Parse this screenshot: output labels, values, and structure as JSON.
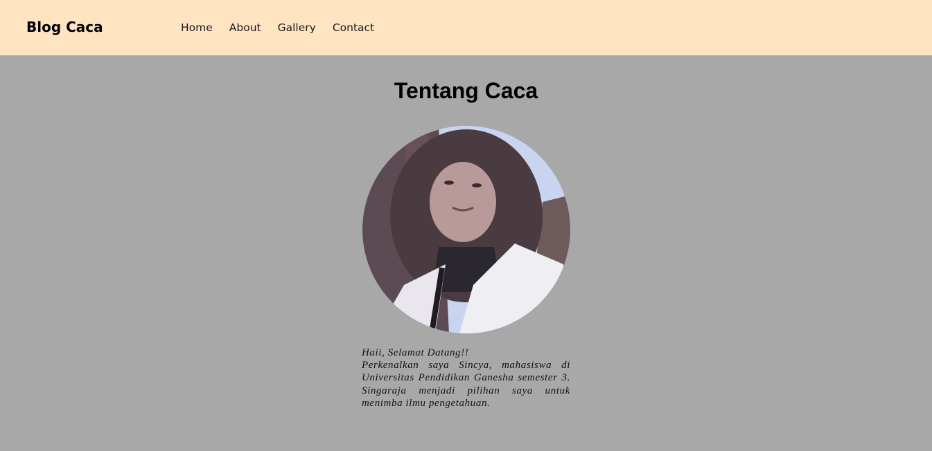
{
  "header": {
    "brand": "Blog Caca",
    "nav": [
      "Home",
      "About",
      "Gallery",
      "Contact"
    ],
    "background_color": "#ffe4c2"
  },
  "main": {
    "title": "Tentang Caca",
    "background_color": "#a8a8a8",
    "greeting": "Haii, Selamat Datang!!",
    "intro": "Perkenalkan saya Sincya, mahasiswa di Universitas Pendidikan Ganesha semester 3. Singaraja menjadi pilihan saya untuk menimba ilmu pengetahuan."
  }
}
